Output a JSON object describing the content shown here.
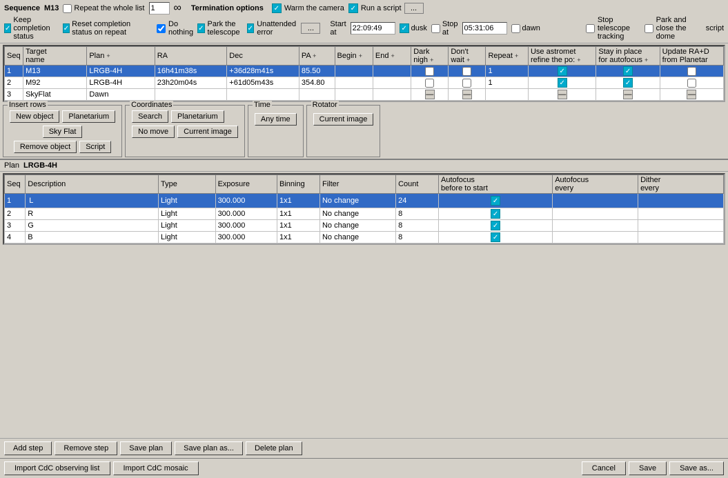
{
  "sequence": {
    "label": "Sequence",
    "value": "M13",
    "repeat_label": "Repeat the whole list",
    "repeat_value": "1",
    "keep_completion": "Keep completion status",
    "reset_completion": "Reset completion status on repeat",
    "start_at_label": "Start at",
    "start_time": "22:09:49",
    "dusk_label": "dusk",
    "stop_at_label": "Stop at",
    "stop_time": "05:31:06",
    "dawn_label": "dawn"
  },
  "termination": {
    "label": "Termination options",
    "warm_camera": "Warm the camera",
    "run_script": "Run a script",
    "do_nothing": "Do nothing",
    "park_telescope": "Park the telescope",
    "unattended_error": "Unattended error",
    "stop_tracking": "Stop telescope tracking",
    "park_close": "Park and close the dome",
    "script_label": "script"
  },
  "seq_table": {
    "headers": [
      "Seq",
      "Target name",
      "Plan",
      "RA",
      "Dec",
      "PA",
      "Begin",
      "End",
      "Dark nigh",
      "Don't wait",
      "Repeat",
      "Use astromet refine the po:",
      "Stay in place for autofocus",
      "Update RA+D from Planetar"
    ],
    "rows": [
      {
        "seq": "1",
        "target": "M13",
        "plan": "LRGB-4H",
        "ra": "16h41m38s",
        "dec": "+36d28m41s",
        "pa": "85.50",
        "begin": "",
        "end": "",
        "dark": false,
        "dont": false,
        "repeat": "1",
        "astromet": true,
        "stay": true,
        "update": false,
        "selected": true
      },
      {
        "seq": "2",
        "target": "M92",
        "plan": "LRGB-4H",
        "ra": "23h20m04s",
        "dec": "+61d05m43s",
        "pa": "354.80",
        "begin": "",
        "end": "",
        "dark": false,
        "dont": false,
        "repeat": "1",
        "astromet": true,
        "stay": true,
        "update": false,
        "selected": false
      },
      {
        "seq": "3",
        "target": "SkyFlat",
        "plan": "Dawn",
        "ra": "",
        "dec": "",
        "pa": "",
        "begin": "",
        "end": "",
        "dark": "minus",
        "dont": "minus",
        "repeat": "",
        "astromet": "minus",
        "stay": "minus",
        "update": "minus",
        "selected": false
      }
    ]
  },
  "insert_rows": {
    "label": "Insert rows",
    "new_object": "New object",
    "planetarium": "Planetarium",
    "sky_flat": "Sky Flat",
    "script": "Script",
    "remove_object": "Remove object"
  },
  "coordinates": {
    "label": "Coordinates",
    "search": "Search",
    "planetarium": "Planetarium",
    "no_move": "No move",
    "current_image": "Current image"
  },
  "time": {
    "label": "Time",
    "any_time": "Any time"
  },
  "rotator": {
    "label": "Rotator",
    "current_image": "Current image"
  },
  "plan": {
    "label": "Plan",
    "name": "LRGB-4H",
    "headers": [
      "Seq",
      "Description",
      "Type",
      "Exposure",
      "Binning",
      "Filter",
      "Count",
      "Autofocus before to start",
      "Autofocus every",
      "Dither every"
    ],
    "rows": [
      {
        "seq": "1",
        "desc": "L",
        "type": "Light",
        "exposure": "300.000",
        "binning": "1x1",
        "filter": "No change",
        "count": "24",
        "af_start": true,
        "af_every": false,
        "dither": false,
        "selected": true
      },
      {
        "seq": "2",
        "desc": "R",
        "type": "Light",
        "exposure": "300.000",
        "binning": "1x1",
        "filter": "No change",
        "count": "8",
        "af_start": true,
        "af_every": false,
        "dither": false,
        "selected": false
      },
      {
        "seq": "3",
        "desc": "G",
        "type": "Light",
        "exposure": "300.000",
        "binning": "1x1",
        "filter": "No change",
        "count": "8",
        "af_start": true,
        "af_every": false,
        "dither": false,
        "selected": false
      },
      {
        "seq": "4",
        "desc": "B",
        "type": "Light",
        "exposure": "300.000",
        "binning": "1x1",
        "filter": "No change",
        "count": "8",
        "af_start": true,
        "af_every": false,
        "dither": false,
        "selected": false
      }
    ]
  },
  "plan_buttons": {
    "add_step": "Add step",
    "remove_step": "Remove step",
    "save_plan": "Save plan",
    "save_plan_as": "Save plan as...",
    "delete_plan": "Delete plan"
  },
  "footer": {
    "import_cdc": "Import CdC observing list",
    "import_mosaic": "Import CdC mosaic",
    "cancel": "Cancel",
    "save": "Save",
    "save_as": "Save as..."
  }
}
